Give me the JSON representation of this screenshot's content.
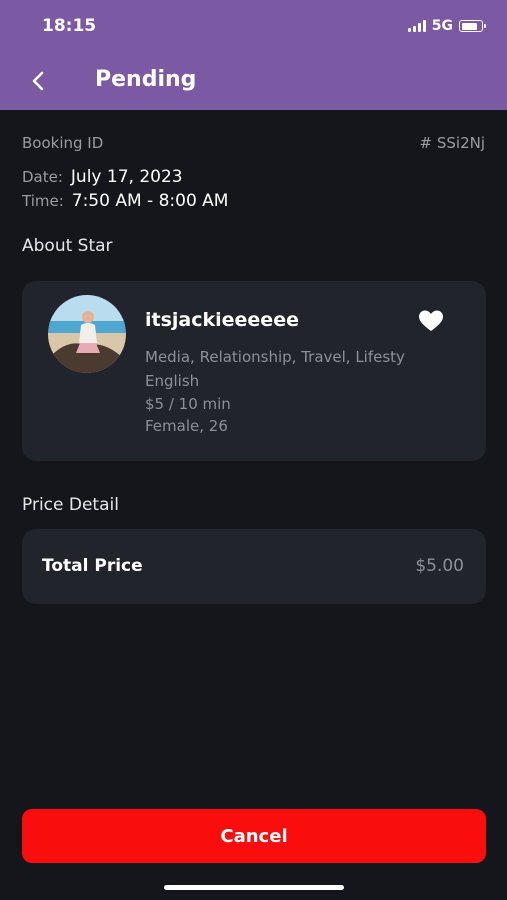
{
  "status_bar": {
    "time": "18:15",
    "network": "5G"
  },
  "header": {
    "title": "Pending"
  },
  "booking": {
    "id_label": "Booking ID",
    "id_value": "# SSi2Nj",
    "date_label": "Date:",
    "date_value": "July 17, 2023",
    "time_label": "Time:",
    "time_value": "7:50 AM - 8:00 AM"
  },
  "about_star": {
    "section_title": "About Star",
    "name": "itsjackieeeeee",
    "categories": "Media, Relationship, Travel, Lifesty",
    "language": "English",
    "rate": "$5 / 10 min",
    "gender_age": "Female, 26",
    "favorited": true
  },
  "price_detail": {
    "section_title": "Price Detail",
    "total_label": "Total Price",
    "total_value": "$5.00"
  },
  "actions": {
    "cancel_label": "Cancel"
  },
  "colors": {
    "header_bg": "#7b5aa3",
    "page_bg": "#15161b",
    "card_bg": "#22242b",
    "cancel_bg": "#f90d0d",
    "muted_text": "#9a9ca4"
  },
  "icons": [
    "back-chevron-icon",
    "heart-icon",
    "signal-icon",
    "battery-icon"
  ]
}
